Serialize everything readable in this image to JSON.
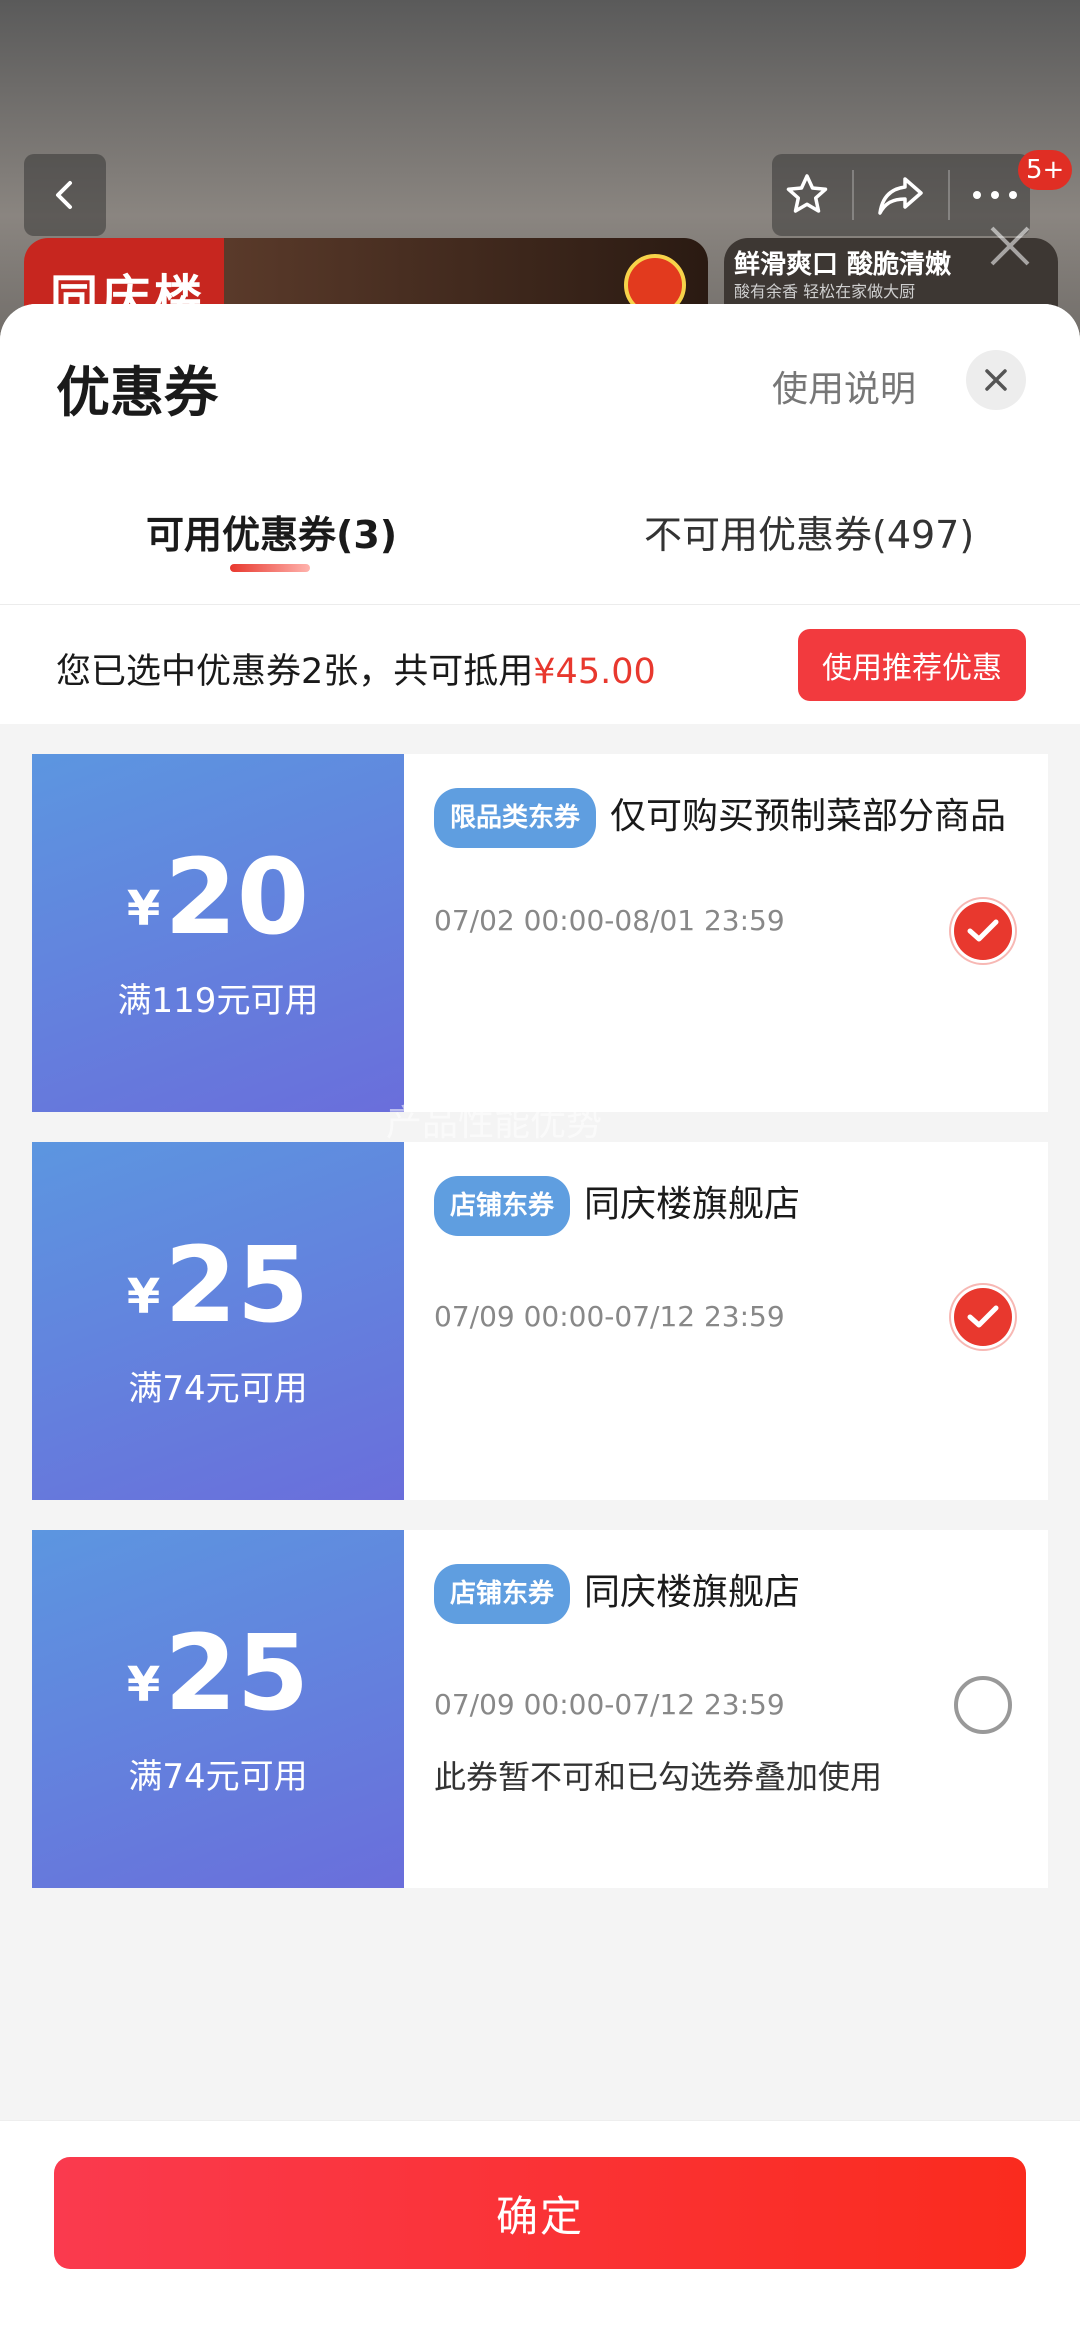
{
  "background": {
    "badge": "5+",
    "banner_brand": "同庆楼",
    "banner_right_title": "鲜滑爽口 酸脆清嫩",
    "banner_right_sub": "酸有余香 轻松在家做大厨"
  },
  "sheet": {
    "title": "优惠券",
    "help": "使用说明",
    "tabs": [
      {
        "label": "可用优惠券(3)"
      },
      {
        "label": "不可用优惠券(497)"
      }
    ]
  },
  "summary": {
    "text": "您已选中优惠券2张，共可抵用",
    "amount": "¥45.00",
    "recommend": "使用推荐优惠"
  },
  "coupons": [
    {
      "yen": "¥",
      "amount": "20",
      "condition": "满119元可用",
      "tag": "限品类东券",
      "title": "仅可购买预制菜部分商品",
      "validity": "07/02 00:00-08/01 23:59",
      "note": "",
      "checked": true
    },
    {
      "yen": "¥",
      "amount": "25",
      "condition": "满74元可用",
      "tag": "店铺东券",
      "title": "同庆楼旗舰店",
      "validity": "07/09 00:00-07/12 23:59",
      "note": "",
      "checked": true
    },
    {
      "yen": "¥",
      "amount": "25",
      "condition": "满74元可用",
      "tag": "店铺东券",
      "title": "同庆楼旗舰店",
      "validity": "07/09 00:00-07/12 23:59",
      "note": "此券暂不可和已勾选券叠加使用",
      "checked": false
    }
  ],
  "watermark": "产品性能优势",
  "footer": {
    "confirm": "确定"
  },
  "colors": {
    "accent": "#e8382e",
    "coupon_blue": "#5c96e0",
    "tag_blue": "#5f9ee0"
  }
}
